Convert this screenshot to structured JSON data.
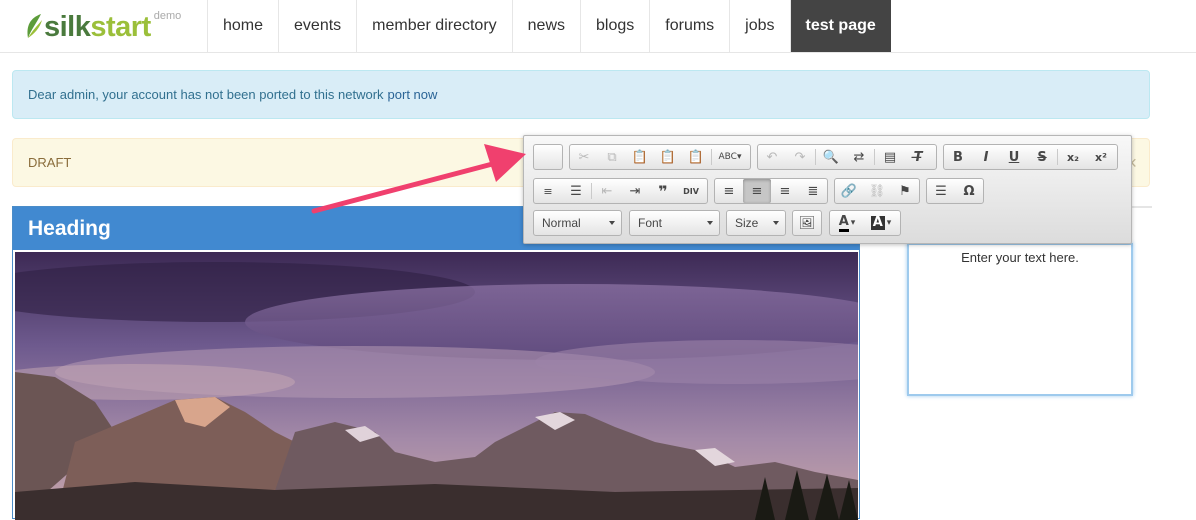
{
  "brand": {
    "name_part1": "silk",
    "name_part2": "start",
    "badge": "demo"
  },
  "nav": {
    "items": [
      {
        "label": "home"
      },
      {
        "label": "events"
      },
      {
        "label": "member directory"
      },
      {
        "label": "news"
      },
      {
        "label": "blogs"
      },
      {
        "label": "forums"
      },
      {
        "label": "jobs"
      },
      {
        "label": "test page"
      }
    ],
    "active": "test page"
  },
  "alert": {
    "message": "Dear admin, your account has not been ported to this network",
    "link": "port now"
  },
  "draft": {
    "label": "DRAFT"
  },
  "content": {
    "heading": "Heading",
    "editable_text": "Enter your text here."
  },
  "toolbar": {
    "format_combo": "Normal",
    "font_combo": "Font",
    "size_combo": "Size",
    "text_color_label": "A",
    "bg_color_label": "A"
  },
  "colors": {
    "heading_bar": "#4189d0",
    "alert_bg": "#d9edf7",
    "draft_bg": "#fcf8e3",
    "active_nav": "#444444",
    "annotation_arrow": "#f0406e",
    "logo_green": "#4a7a3d"
  }
}
